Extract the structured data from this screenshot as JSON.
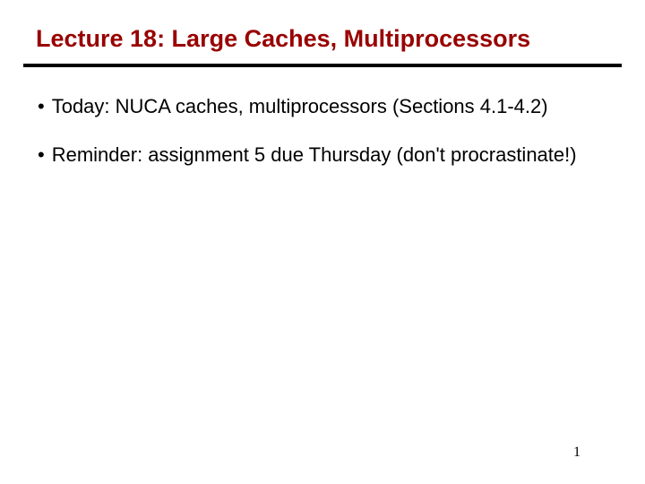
{
  "title": "Lecture 18: Large Caches, Multiprocessors",
  "bullets": [
    "Today:  NUCA caches, multiprocessors (Sections 4.1-4.2)",
    "Reminder: assignment 5 due Thursday  (don't procrastinate!)"
  ],
  "page_number": "1"
}
